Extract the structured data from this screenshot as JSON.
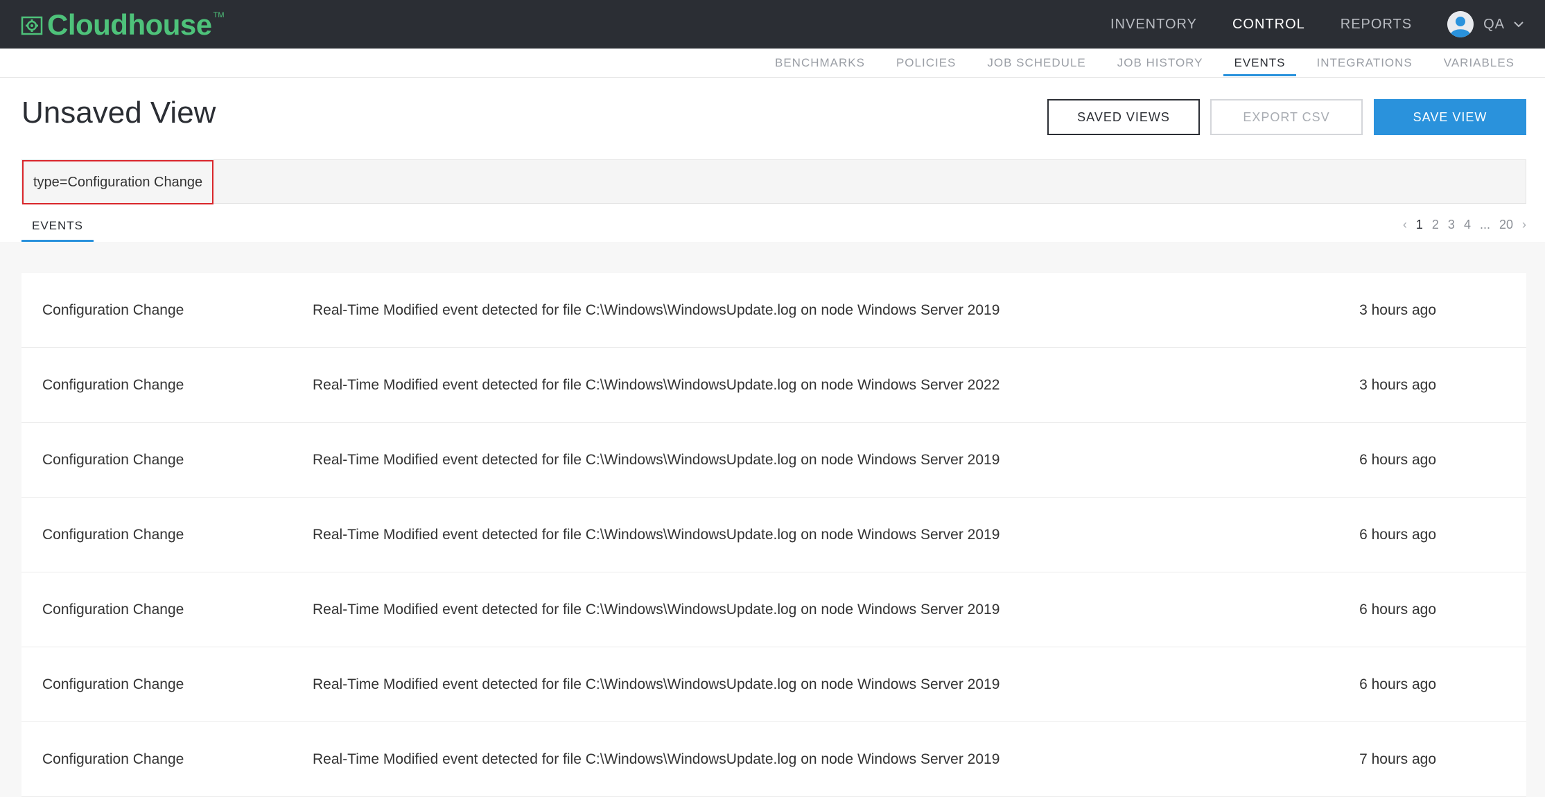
{
  "brand": {
    "name": "Cloudhouse",
    "tm": "TM",
    "accent": "#4ec27a"
  },
  "main_nav": {
    "items": [
      {
        "label": "INVENTORY",
        "active": false
      },
      {
        "label": "CONTROL",
        "active": true
      },
      {
        "label": "REPORTS",
        "active": false
      }
    ],
    "user": {
      "name": "QA",
      "icon": "user-avatar-icon"
    }
  },
  "sub_nav": {
    "items": [
      {
        "label": "BENCHMARKS",
        "active": false
      },
      {
        "label": "POLICIES",
        "active": false
      },
      {
        "label": "JOB SCHEDULE",
        "active": false
      },
      {
        "label": "JOB HISTORY",
        "active": false
      },
      {
        "label": "EVENTS",
        "active": true
      },
      {
        "label": "INTEGRATIONS",
        "active": false
      },
      {
        "label": "VARIABLES",
        "active": false
      }
    ],
    "active_color": "#2a92dc"
  },
  "page": {
    "title": "Unsaved View",
    "buttons": {
      "saved_views": "SAVED VIEWS",
      "export_csv": "EXPORT CSV",
      "save_view": "SAVE VIEW"
    },
    "filter": "type=Configuration Change",
    "tab": "EVENTS"
  },
  "pagination": {
    "prev": "‹",
    "pages": [
      "1",
      "2",
      "3",
      "4",
      "...",
      "20"
    ],
    "current": "1",
    "next": "›"
  },
  "events": [
    {
      "type": "Configuration Change",
      "description": "Real-Time Modified event detected for file C:\\Windows\\WindowsUpdate.log on node Windows Server 2019",
      "time": "3 hours ago"
    },
    {
      "type": "Configuration Change",
      "description": "Real-Time Modified event detected for file C:\\Windows\\WindowsUpdate.log on node Windows Server 2022",
      "time": "3 hours ago"
    },
    {
      "type": "Configuration Change",
      "description": "Real-Time Modified event detected for file C:\\Windows\\WindowsUpdate.log on node Windows Server 2019",
      "time": "6 hours ago"
    },
    {
      "type": "Configuration Change",
      "description": "Real-Time Modified event detected for file C:\\Windows\\WindowsUpdate.log on node Windows Server 2019",
      "time": "6 hours ago"
    },
    {
      "type": "Configuration Change",
      "description": "Real-Time Modified event detected for file C:\\Windows\\WindowsUpdate.log on node Windows Server 2019",
      "time": "6 hours ago"
    },
    {
      "type": "Configuration Change",
      "description": "Real-Time Modified event detected for file C:\\Windows\\WindowsUpdate.log on node Windows Server 2019",
      "time": "6 hours ago"
    },
    {
      "type": "Configuration Change",
      "description": "Real-Time Modified event detected for file C:\\Windows\\WindowsUpdate.log on node Windows Server 2019",
      "time": "7 hours ago"
    }
  ]
}
